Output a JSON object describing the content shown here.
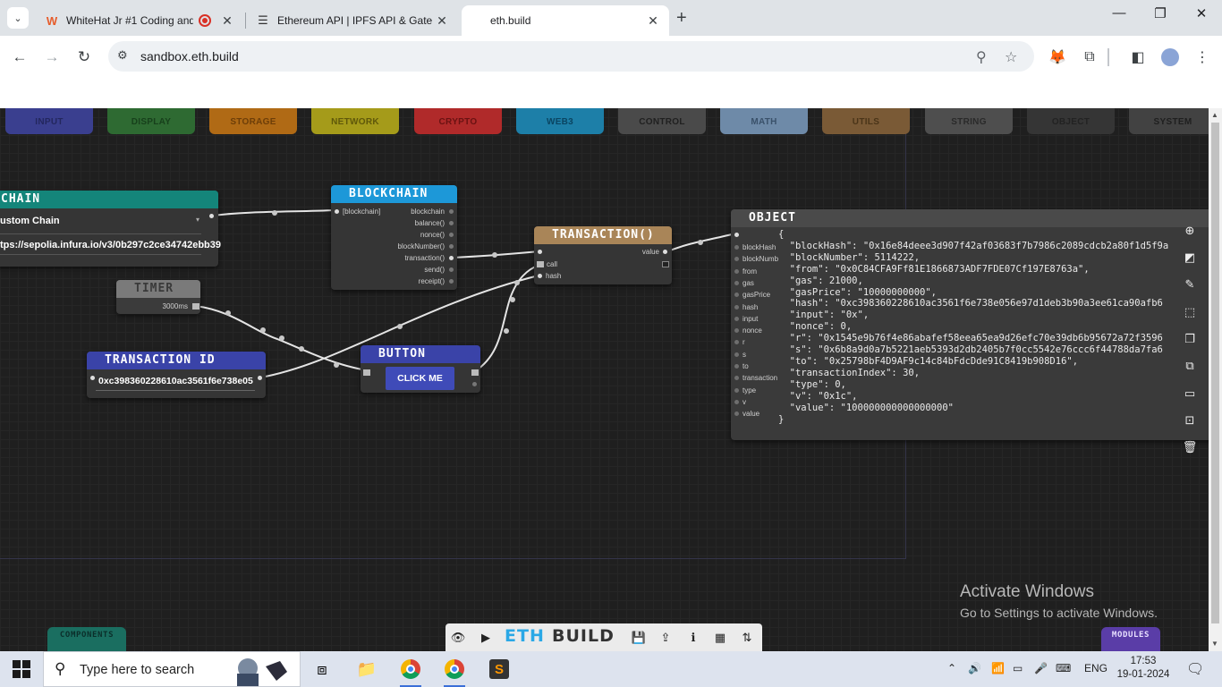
{
  "browser": {
    "tabs": [
      {
        "title": "WhiteHat Jr #1 Coding and",
        "favicon": "whitehat-logo"
      },
      {
        "title": "Ethereum API | IPFS API & Gate",
        "favicon": "infura-logo"
      },
      {
        "title": "eth.build",
        "favicon": "none"
      }
    ],
    "url": "sandbox.eth.build"
  },
  "categories": [
    {
      "label": "INPUT",
      "color": "#3a3f8f",
      "text": "#23275e"
    },
    {
      "label": "DISPLAY",
      "color": "#2e6a32",
      "text": "#17401b"
    },
    {
      "label": "STORAGE",
      "color": "#b06a15",
      "text": "#6d3e08"
    },
    {
      "label": "NETWORK",
      "color": "#a59b1a",
      "text": "#5f580a"
    },
    {
      "label": "CRYPTO",
      "color": "#b02a2a",
      "text": "#6a1212"
    },
    {
      "label": "WEB3",
      "color": "#1d7fa8",
      "text": "#0a4562"
    },
    {
      "label": "CONTROL",
      "color": "#4a4a4a",
      "text": "#202020"
    },
    {
      "label": "MATH",
      "color": "#6e8aa8",
      "text": "#3a516a"
    },
    {
      "label": "UTILS",
      "color": "#7a5a36",
      "text": "#4a3418"
    },
    {
      "label": "STRING",
      "color": "#4e4e4e",
      "text": "#2a2a2a"
    },
    {
      "label": "OBJECT",
      "color": "#353535",
      "text": "#222222"
    },
    {
      "label": "SYSTEM",
      "color": "#424242",
      "text": "#1f1f1f"
    }
  ],
  "nodes": {
    "chain": {
      "title": "CHAIN",
      "select_value": "ustom Chain",
      "url_value": "tps://sepolia.infura.io/v3/0b297c2ce34742ebb39",
      "color": "#14857a"
    },
    "blockchain": {
      "title": "BLOCKCHAIN",
      "input_label": "[blockchain]",
      "outputs": [
        "blockchain",
        "balance()",
        "nonce()",
        "blockNumber()",
        "transaction()",
        "send()",
        "receipt()"
      ],
      "color": "#1d98d8"
    },
    "timer": {
      "title": "TIMER",
      "output": "3000ms",
      "color": "#6a6a6a"
    },
    "transaction_id": {
      "title": "TRANSACTION ID",
      "value": "0xc398360228610ac3561f6e738e05",
      "color": "#3a43a8"
    },
    "button": {
      "title": "BUTTON",
      "label": "CLICK ME",
      "color": "#3a43a8"
    },
    "transaction": {
      "title": "TRANSACTION()",
      "inputs": [
        "call",
        "hash"
      ],
      "output": "value",
      "color": "#a98558"
    },
    "object": {
      "title": "OBJECT",
      "inputs": [
        "blockHash",
        "blockNumb",
        "from",
        "gas",
        "gasPrice",
        "hash",
        "input",
        "nonce",
        "r",
        "s",
        "to",
        "transaction",
        "type",
        "v",
        "value"
      ],
      "body": "{\n  \"blockHash\": \"0x16e84deee3d907f42af03683f7b7986c2089cdcb2a80f1d5f9a\n  \"blockNumber\": 5114222,\n  \"from\": \"0x0C84CFA9Ff81E1866873ADF7FDE07Cf197E8763a\",\n  \"gas\": 21000,\n  \"gasPrice\": \"10000000000\",\n  \"hash\": \"0xc398360228610ac3561f6e738e056e97d1deb3b90a3ee61ca90afb6\n  \"input\": \"0x\",\n  \"nonce\": 0,\n  \"r\": \"0x1545e9b76f4e86abafef58eea65ea9d26efc70e39db6b95672a72f3596\n  \"s\": \"0x6b8a9d0a7b5221aeb5393d2db2405b7f0cc5542e76ccc6f44788da7fa6\n  \"to\": \"0x25798bF4D9AF9c14c84bFdcDde91C8419b908D16\",\n  \"transactionIndex\": 30,\n  \"type\": 0,\n  \"v\": \"0x1c\",\n  \"value\": \"100000000000000000\"\n}",
      "color": "#4a4a4a"
    }
  },
  "side_tools": [
    "plus-circle-icon",
    "resize-icon",
    "pencil-icon",
    "select-icon",
    "copy-icon",
    "clone-icon",
    "comment-icon",
    "group-icon",
    "trash-icon"
  ],
  "watermark": {
    "title": "Activate Windows",
    "subtitle": "Go to Settings to activate Windows."
  },
  "bottom": {
    "components_label": "COMPONENTS",
    "modules_label": "MODULES",
    "logo_eth": "ETH",
    "logo_build": "BUILD"
  },
  "taskbar": {
    "search_placeholder": "Type here to search",
    "language": "ENG",
    "time": "17:53",
    "date": "19-01-2024"
  }
}
